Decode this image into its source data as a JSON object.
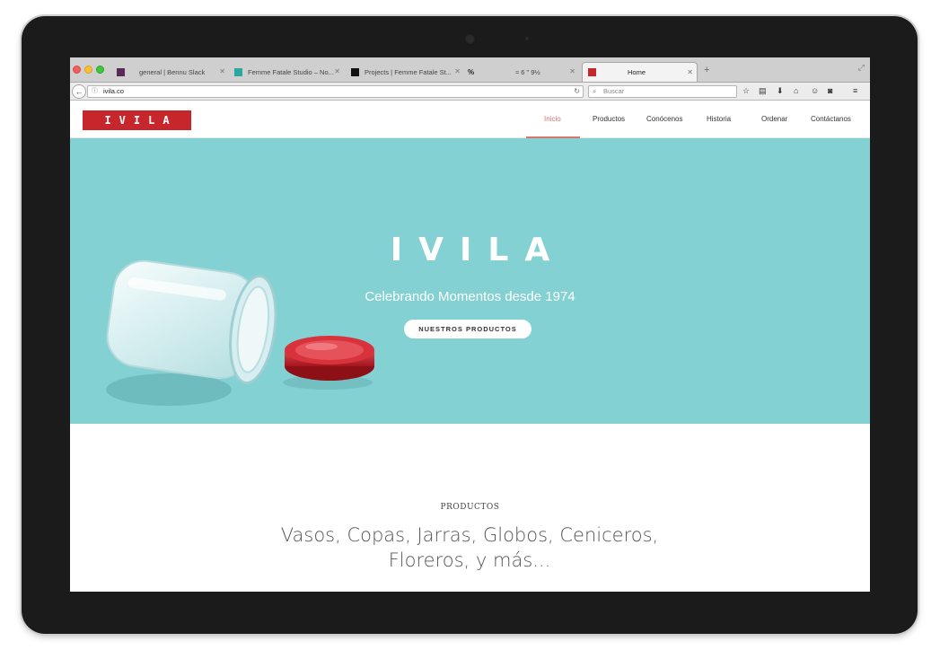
{
  "browser": {
    "tabs": [
      {
        "label": "general | Bennu Slack",
        "icon": "slack-icon"
      },
      {
        "label": "Femme Fatale Studio – No...",
        "icon": "teal-square-icon"
      },
      {
        "label": "Projects | Femme Fatale St...",
        "icon": "ff-logo-icon"
      },
      {
        "label": "≈ 6 \" 9½",
        "icon": "infinity-icon"
      },
      {
        "label": "Home",
        "icon": "ivila-favicon"
      }
    ],
    "url": "ivila.co",
    "search_placeholder": "Buscar"
  },
  "site": {
    "logo": "IVILA",
    "nav": [
      "Inicio",
      "Productos",
      "Conócenos",
      "Historia",
      "Ordenar",
      "Contáctanos"
    ],
    "active_nav": "Inicio",
    "colors": {
      "brand_red": "#c7262d",
      "hero_bg": "#83d1d3",
      "accent": "#d6746e"
    }
  },
  "hero": {
    "title": "IVILA",
    "subtitle": "Celebrando Momentos desde 1974",
    "button": "NUESTROS PRODUCTOS"
  },
  "products": {
    "label": "PRODUCTOS",
    "text": "Vasos, Copas, Jarras, Globos,  Ceniceros, Floreros, y más..."
  }
}
